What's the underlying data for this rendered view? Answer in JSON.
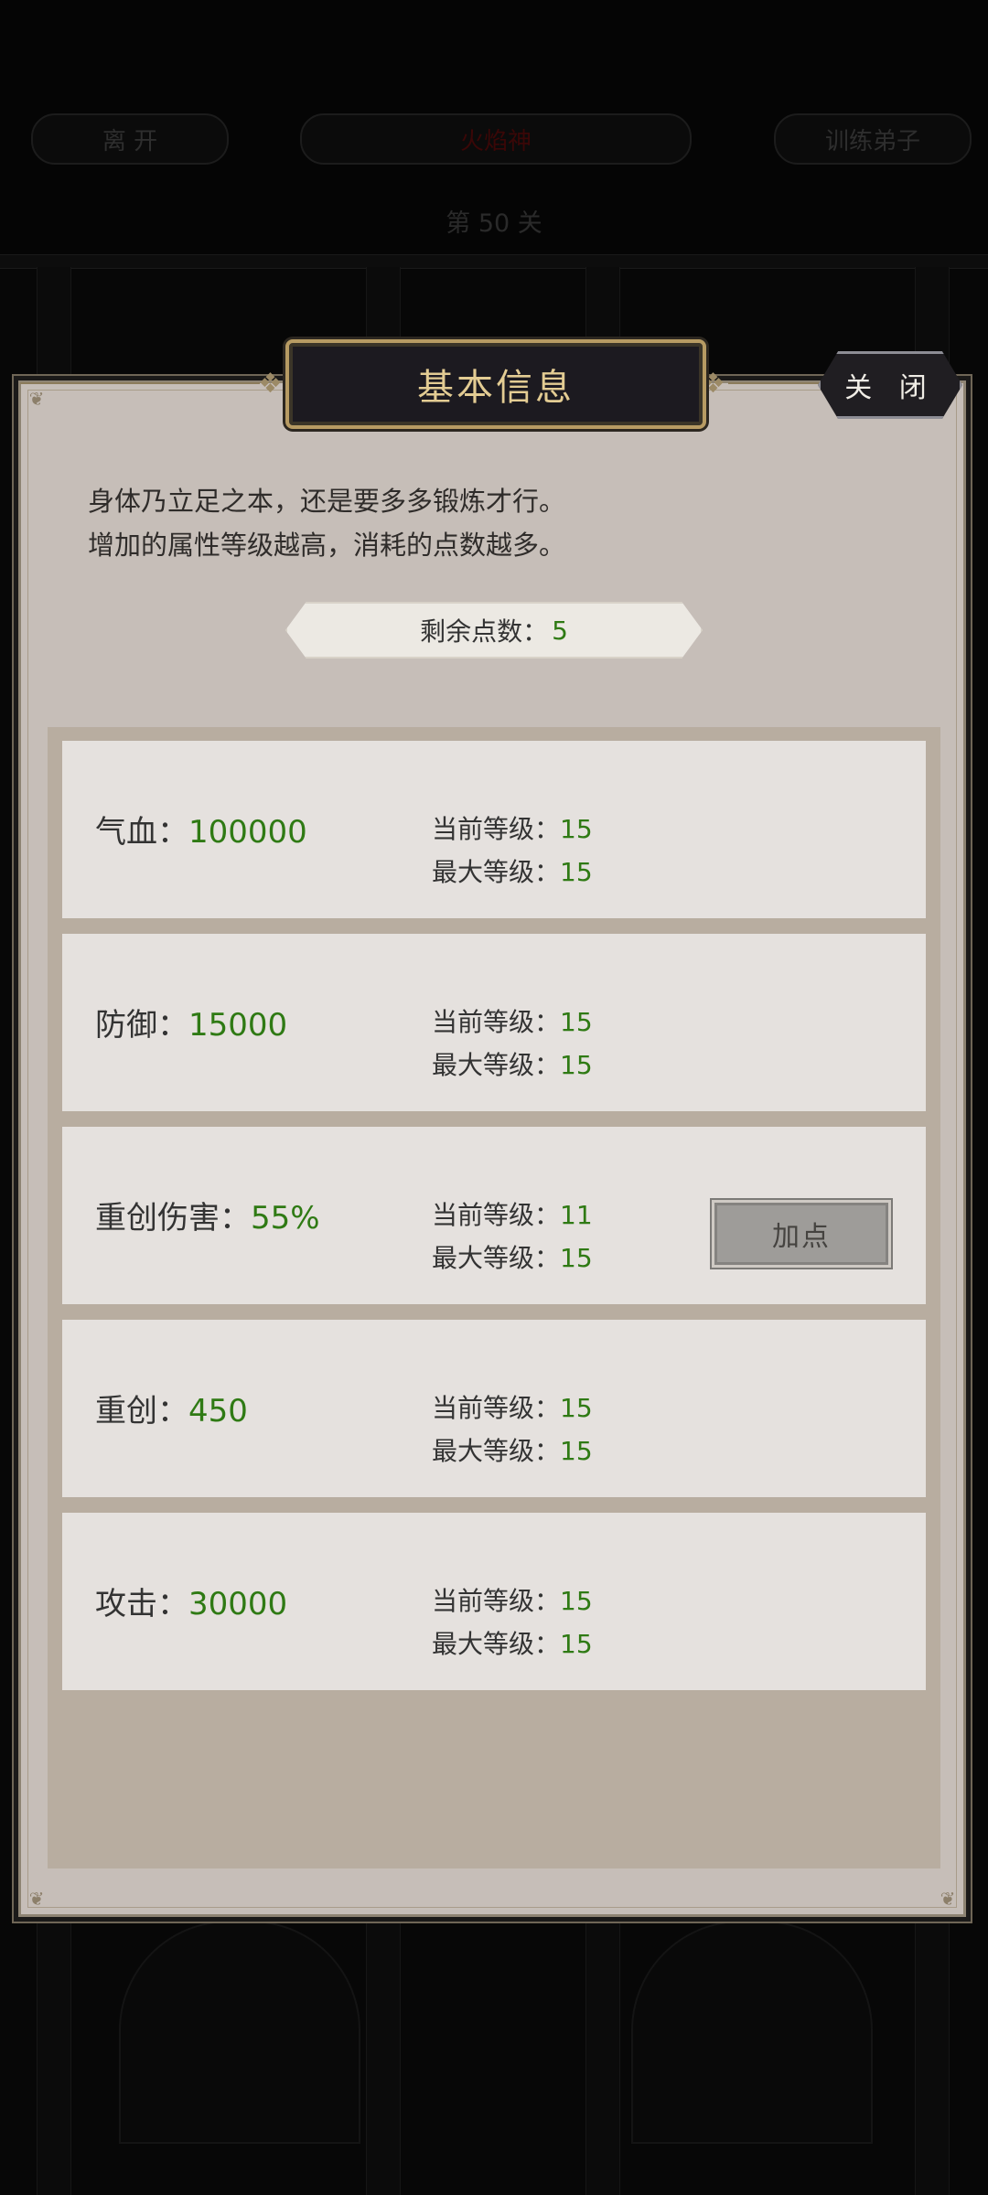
{
  "background": {
    "leave_label": "离 开",
    "center_label": "火焰神",
    "train_label": "训练弟子",
    "level_label": "第 50 关"
  },
  "modal": {
    "title": "基本信息",
    "close_label": "关 闭",
    "description": [
      "身体乃立足之本，还是要多多锻炼才行。",
      "增加的属性等级越高，消耗的点数越多。"
    ],
    "points_label": "剩余点数：",
    "points_value": "5"
  },
  "stats": [
    {
      "name": "气血：",
      "value": "100000",
      "current_label": "当前等级：",
      "current": "15",
      "max_label": "最大等级：",
      "max": "15"
    },
    {
      "name": "防御：",
      "value": "15000",
      "current_label": "当前等级：",
      "current": "15",
      "max_label": "最大等级：",
      "max": "15"
    },
    {
      "name": "重创伤害：",
      "value": "55%",
      "current_label": "当前等级：",
      "current": "11",
      "max_label": "最大等级：",
      "max": "15",
      "button": "加点"
    },
    {
      "name": "重创：",
      "value": "450",
      "current_label": "当前等级：",
      "current": "15",
      "max_label": "最大等级：",
      "max": "15"
    },
    {
      "name": "攻击：",
      "value": "30000",
      "current_label": "当前等级：",
      "current": "15",
      "max_label": "最大等级：",
      "max": "15"
    }
  ],
  "colors": {
    "accent_value": "#2f7a14",
    "title_gold": "#e3cc93",
    "modal_bg": "#c6beb8"
  }
}
